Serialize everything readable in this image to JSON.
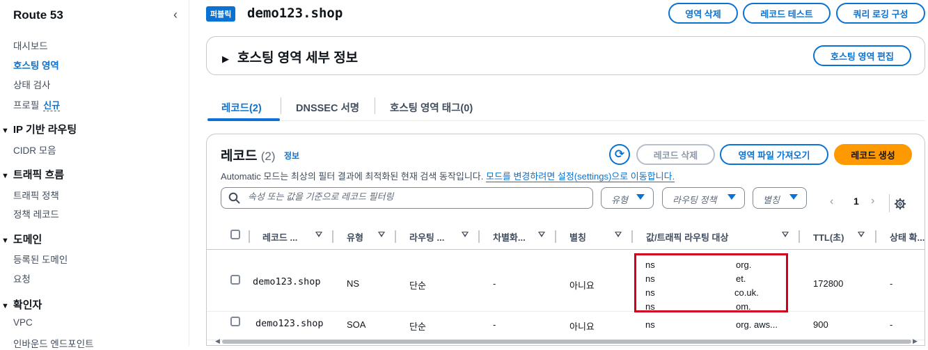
{
  "sidebar": {
    "title": "Route 53",
    "items": [
      {
        "label": "대시보드",
        "active": false
      },
      {
        "label": "호스팅 영역",
        "active": true
      },
      {
        "label": "상태 검사",
        "active": false
      },
      {
        "label": "프로필",
        "badge": "신규",
        "active": false
      }
    ],
    "sections": [
      {
        "title": "IP 기반 라우팅",
        "items": [
          "CIDR 모음"
        ]
      },
      {
        "title": "트래픽 흐름",
        "items": [
          "트래픽 정책",
          "정책 레코드"
        ]
      },
      {
        "title": "도메인",
        "items": [
          "등록된 도메인",
          "요청"
        ]
      },
      {
        "title": "확인자",
        "items": [
          "VPC",
          "인바운드 엔드포인트"
        ]
      }
    ]
  },
  "header": {
    "badge": "퍼블릭",
    "zone_name": "demo123.shop",
    "buttons": {
      "delete_zone": "영역 삭제",
      "test_record": "레코드 테스트",
      "query_logging": "쿼리 로깅 구성"
    }
  },
  "details": {
    "title": "호스팅 영역 세부 정보",
    "edit_button": "호스팅 영역 편집"
  },
  "tabs": [
    {
      "label": "레코드(2)",
      "active": true
    },
    {
      "label": "DNSSEC 서명",
      "active": false
    },
    {
      "label": "호스팅 영역 태그(0)",
      "active": false
    }
  ],
  "records": {
    "title": "레코드",
    "count": "(2)",
    "info_link": "정보",
    "note_prefix": "Automatic 모드는 최상의 필터 결과에 최적화된 현재 검색 동작입니다.",
    "note_link": "모드를 변경하려면 설정(settings)으로 이동합니다.",
    "buttons": {
      "delete": "레코드 삭제",
      "import": "영역 파일 가져오기",
      "create": "레코드 생성"
    },
    "search_placeholder": "속성 또는 값을 기준으로 레코드 필터링",
    "filters": {
      "type": "유형",
      "routing": "라우팅 정책",
      "alias": "별칭"
    },
    "page": "1",
    "columns": [
      "레코드 ...",
      "유형",
      "라우팅 ...",
      "차별화...",
      "별칭",
      "값/트래픽 라우팅 대상",
      "TTL(초)",
      "상태 확..."
    ],
    "rows": [
      {
        "name": "demo123.shop",
        "type": "NS",
        "routing": "단순",
        "diff": "-",
        "alias": "아니요",
        "values": [
          "ns",
          "ns",
          "ns",
          "ns"
        ],
        "value_suffixes": [
          "org.",
          "et.",
          "co.uk.",
          "om."
        ],
        "ttl": "172800",
        "health": "-"
      },
      {
        "name": "demo123.shop",
        "type": "SOA",
        "routing": "단순",
        "diff": "-",
        "alias": "아니요",
        "values": [
          "ns"
        ],
        "value_suffixes": [
          "org. aws..."
        ],
        "ttl": "900",
        "health": "-"
      }
    ]
  },
  "colors": {
    "accent": "#0972d3",
    "primary_button": "#ff9900",
    "highlight_box": "#d0021b"
  }
}
